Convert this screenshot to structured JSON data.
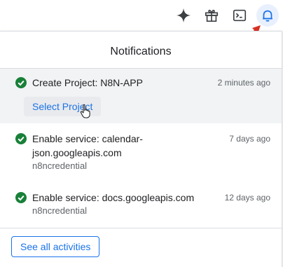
{
  "toolbar": {
    "icons": [
      "sparkle-icon",
      "gift-icon",
      "terminal-icon",
      "bell-icon"
    ]
  },
  "panel": {
    "title": "Notifications",
    "notifications": [
      {
        "title": "Create Project: N8N-APP",
        "time": "2 minutes ago",
        "action_label": "Select Project"
      },
      {
        "title_line1": "Enable service: calendar-",
        "title_line2": "json.googleapis.com",
        "time": "7 days ago",
        "subtitle": "n8ncredential"
      },
      {
        "title": "Enable service: docs.googleapis.com",
        "time": "12 days ago",
        "subtitle": "n8ncredential"
      }
    ],
    "see_all_label": "See all activities"
  },
  "colors": {
    "accent": "#1a73e8",
    "success": "#188038",
    "annotation_arrow": "#d93025"
  }
}
